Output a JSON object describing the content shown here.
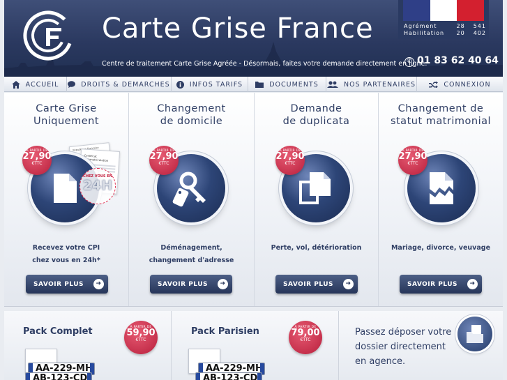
{
  "header": {
    "title": "Carte Grise France",
    "tagline": "Centre de traitement Carte Grise Agréée - Désormais, faites votre demande directement en ligne.",
    "phone": "01 83 62 40 64",
    "badge": {
      "rows": [
        {
          "label": "Agrément",
          "num1": "28",
          "num2": "541"
        },
        {
          "label": "Habilitation",
          "num1": "20",
          "num2": "402"
        }
      ],
      "flag_colors": [
        "#2f3f87",
        "#ffffff",
        "#d3202f"
      ]
    }
  },
  "nav": [
    {
      "label": "ACCUEIL",
      "icon": "home-icon"
    },
    {
      "label": "DROITS & DEMARCHES",
      "icon": "speech-bubble-icon"
    },
    {
      "label": "INFOS TARIFS",
      "icon": "info-icon"
    },
    {
      "label": "DOCUMENTS",
      "icon": "folder-icon"
    },
    {
      "label": "NOS PARTENAIRES",
      "icon": "users-icon"
    },
    {
      "label": "CONNEXION",
      "icon": "shuffle-icon"
    }
  ],
  "services": [
    {
      "title": "Carte Grise\nUniquement",
      "desc": "Recevez votre CPI\nchez vous en 24h*",
      "button": "SAVOIR PLUS",
      "price_from": "À PARTIR DE",
      "price": "27,90",
      "price_unit": "€TTC",
      "icon": "document-icon",
      "badge_top": "CHEZ VOUS EN",
      "badge_main": "24H",
      "doc_header": "République Française",
      "doc_title": "Certificat d'immatriculation"
    },
    {
      "title": "Changement\nde domicile",
      "desc": "Déménagement,\nchangement d'adresse",
      "button": "SAVOIR PLUS",
      "price_from": "À PARTIR DE",
      "price": "27,90",
      "price_unit": "€TTC",
      "icon": "key-icon"
    },
    {
      "title": "Demande\nde duplicata",
      "desc": "Perte, vol, détérioration",
      "button": "SAVOIR PLUS",
      "price_from": "À PARTIR DE",
      "price": "27,90",
      "price_unit": "€TTC",
      "icon": "copy-icon"
    },
    {
      "title": "Changement de\nstatut matrimonial",
      "desc": "Mariage, divorce, veuvage",
      "button": "SAVOIR PLUS",
      "price_from": "À PARTIR DE",
      "price": "27,90",
      "price_unit": "€TTC",
      "icon": "torn-document-icon"
    }
  ],
  "packs": [
    {
      "title": "Pack Complet",
      "price_from": "À PARTIR DE",
      "price": "59,90",
      "price_unit": "€TTC",
      "plates": [
        "AA-229-MH",
        "AB-123-CD"
      ]
    },
    {
      "title": "Pack Parisien",
      "price_from": "À PARTIR DE",
      "price": "79,00",
      "price_unit": "€TTC",
      "plates": [
        "AA-229-MH",
        "AB-123-CD"
      ]
    }
  ],
  "agency": {
    "text": "Passez déposer votre dossier directement en agence.",
    "icon": "folder-document-icon"
  },
  "colors": {
    "navy": "#2f3e64",
    "accent_red": "#c8203f",
    "header_bg": "#2b3960"
  }
}
